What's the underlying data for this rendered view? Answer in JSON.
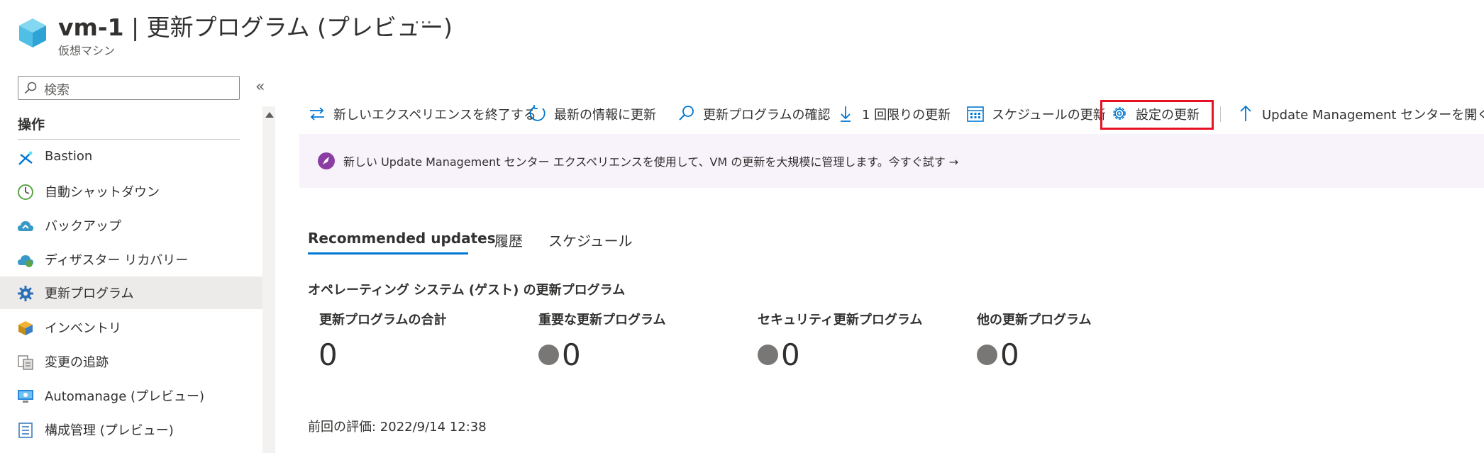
{
  "header": {
    "vm_name": "vm-1",
    "title_rest": " | 更新プログラム (プレビュー)",
    "subtitle": "仮想マシン",
    "more": "···"
  },
  "sidebar": {
    "search_placeholder": "検索",
    "collapse": "«",
    "section": "操作",
    "items": [
      {
        "label": "Bastion",
        "icon": "bastion-icon"
      },
      {
        "label": "自動シャットダウン",
        "icon": "clock-icon"
      },
      {
        "label": "バックアップ",
        "icon": "backup-cloud-icon"
      },
      {
        "label": "ディザスター リカバリー",
        "icon": "disaster-recovery-icon"
      },
      {
        "label": "更新プログラム",
        "icon": "gear-icon"
      },
      {
        "label": "インベントリ",
        "icon": "inventory-box-icon"
      },
      {
        "label": "変更の追跡",
        "icon": "change-tracking-icon"
      },
      {
        "label": "Automanage (プレビュー)",
        "icon": "automanage-monitor-icon"
      },
      {
        "label": "構成管理 (プレビュー)",
        "icon": "config-list-icon"
      }
    ]
  },
  "toolbar": {
    "exit_new": "新しいエクスペリエンスを終了する",
    "refresh": "最新の情報に更新",
    "check_updates": "更新プログラムの確認",
    "one_time": "1 回限りの更新",
    "schedule": "スケジュールの更新",
    "settings": "設定の更新",
    "open_center": "Update Management センターを開く"
  },
  "banner": {
    "text": "新しい Update Management センター エクスペリエンスを使用して、VM の更新を大規模に管理します。今すぐ試す →"
  },
  "tabs": {
    "recommended": "Recommended updates",
    "history": "履歴",
    "schedule": "スケジュール"
  },
  "os_updates": {
    "heading": "オペレーティング システム (ゲスト) の更新プログラム",
    "total_label": "更新プログラムの合計",
    "total_value": "0",
    "critical_label": "重要な更新プログラム",
    "critical_value": "0",
    "security_label": "セキュリティ更新プログラム",
    "security_value": "0",
    "other_label": "他の更新プログラム",
    "other_value": "0"
  },
  "last_assessment": "前回の評価: 2022/9/14 12:38",
  "colors": {
    "accent": "#0078d4",
    "highlight": "#e81123",
    "banner_bg": "#f8f2fb",
    "active_nav": "#edebe9"
  }
}
